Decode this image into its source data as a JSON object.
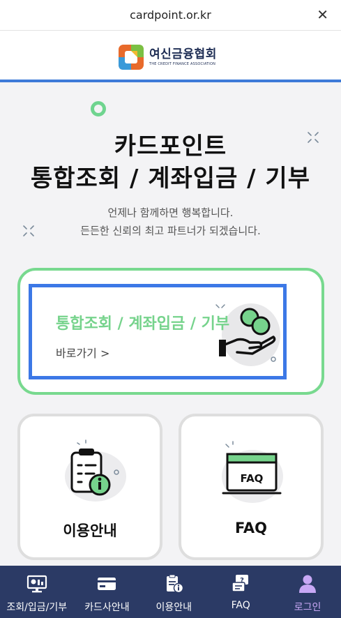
{
  "browser": {
    "url": "cardpoint.or.kr",
    "close_symbol": "✕"
  },
  "header": {
    "logo_main": "여신금융협회",
    "logo_sub": "THE CREDIT FINANCE ASSOCIATION"
  },
  "hero": {
    "title_line1": "카드포인트",
    "title_line2": "통합조회 / 계좌입금 / 기부",
    "subtitle_line1": "언제나 함께하면 행복합니다.",
    "subtitle_line2": "든든한 신뢰의 최고 파트너가 되겠습니다."
  },
  "main_card": {
    "title": "통합조회 / 계좌입금 / 기부",
    "link_label": "바로가기 >",
    "icon": "hand-coin-icon"
  },
  "cards": [
    {
      "label": "이용안내",
      "icon": "clipboard-info-icon"
    },
    {
      "label": "FAQ",
      "icon": "faq-window-icon"
    }
  ],
  "bottom_nav": {
    "items": [
      {
        "label": "조회/입금/기부",
        "icon": "monitor-chart-icon",
        "active": false
      },
      {
        "label": "카드사안내",
        "icon": "credit-card-icon",
        "active": false
      },
      {
        "label": "이용안내",
        "icon": "clipboard-info-icon",
        "active": false
      },
      {
        "label": "FAQ",
        "icon": "faq-chat-icon",
        "active": false
      },
      {
        "label": "로그인",
        "icon": "user-icon",
        "active": true
      }
    ]
  },
  "colors": {
    "accent_green": "#76d38c",
    "focus_blue": "#3c78e6",
    "nav_bg": "#2b3a65",
    "nav_active": "#c8a8f5",
    "header_line": "#3d7ad8"
  }
}
